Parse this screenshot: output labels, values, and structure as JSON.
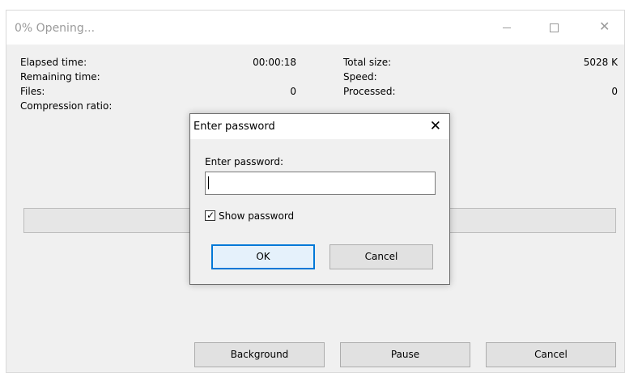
{
  "window": {
    "title": "0% Opening...",
    "controls": {
      "minimize": "—",
      "maximize": "□",
      "close": "✕"
    }
  },
  "stats": {
    "elapsed_label": "Elapsed time:",
    "elapsed_value": "00:00:18",
    "remaining_label": "Remaining time:",
    "files_label": "Files:",
    "files_value": "0",
    "compression_label": "Compression ratio:",
    "total_size_label": "Total size:",
    "total_size_value": "5028 K",
    "speed_label": "Speed:",
    "processed_label": "Processed:",
    "processed_value": "0"
  },
  "progress": {
    "percent": 0
  },
  "buttons": {
    "background": "Background",
    "pause": "Pause",
    "cancel": "Cancel"
  },
  "dialog": {
    "title": "Enter password",
    "close": "✕",
    "prompt": "Enter password:",
    "password_value": "",
    "show_password_label": "Show password",
    "show_password_checked": true,
    "ok": "OK",
    "cancel": "Cancel"
  },
  "colors": {
    "window_bg": "#f0f0f0",
    "titlebar_bg": "#ffffff",
    "title_text": "#9a9a9a",
    "default_button_border": "#0078d7"
  }
}
